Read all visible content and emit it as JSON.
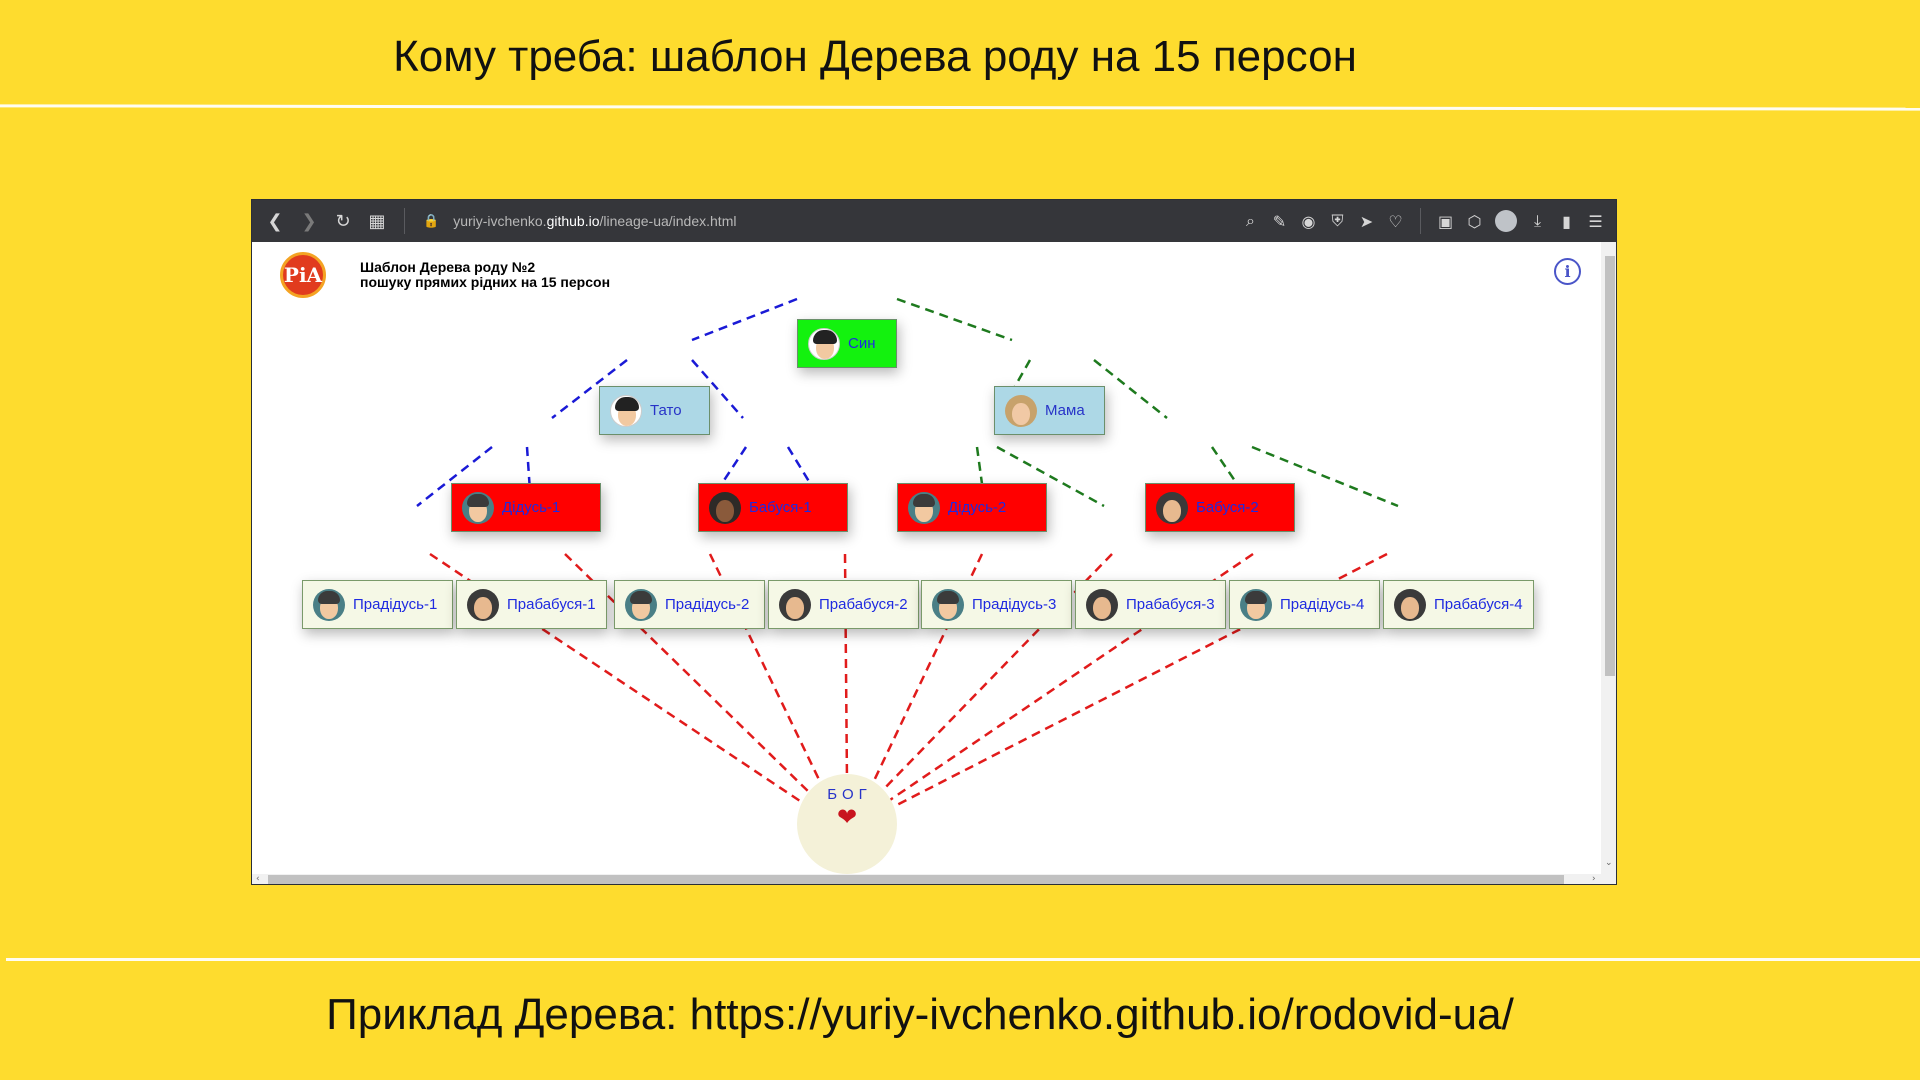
{
  "slide": {
    "title": "Кому треба: шаблон Дерева роду на 15 персон",
    "footer": "Приклад Дерева: https://yuriy-ivchenko.github.io/rodovid-ua/"
  },
  "browser": {
    "url_prefix": "yuriy-ivchenko.",
    "url_host": "github.io",
    "url_path": "/lineage-ua/index.html"
  },
  "page": {
    "logo_text": "PiA",
    "heading_line1": "Шаблон Дерева роду №2",
    "heading_line2": "пошуку прямих рідних на 15 персон"
  },
  "tree": {
    "son": {
      "label": "Син",
      "icon": "boy-avatar-icon"
    },
    "father": {
      "label": "Тато",
      "icon": "man-avatar-icon"
    },
    "mother": {
      "label": "Мама",
      "icon": "woman-avatar-icon"
    },
    "grandparents": [
      {
        "label": "Дідусь-1",
        "icon": "man-avatar-icon"
      },
      {
        "label": "Бабуся-1",
        "icon": "woman-avatar-icon"
      },
      {
        "label": "Дідусь-2",
        "icon": "man-avatar-icon"
      },
      {
        "label": "Бабуся-2",
        "icon": "woman-avatar-icon"
      }
    ],
    "great_grandparents": [
      {
        "label": "Прадідусь-1",
        "icon": "man-avatar-icon"
      },
      {
        "label": "Прабабуся-1",
        "icon": "woman-avatar-icon"
      },
      {
        "label": "Прадідусь-2",
        "icon": "man-avatar-icon"
      },
      {
        "label": "Прабабуся-2",
        "icon": "woman-avatar-icon"
      },
      {
        "label": "Прадідусь-3",
        "icon": "man-avatar-icon"
      },
      {
        "label": "Прабабуся-3",
        "icon": "woman-avatar-icon"
      },
      {
        "label": "Прадідусь-4",
        "icon": "man-avatar-icon"
      },
      {
        "label": "Прабабуся-4",
        "icon": "woman-avatar-icon"
      }
    ],
    "root": {
      "label": "БОГ",
      "icon": "heart-icon"
    }
  },
  "colors": {
    "slide_background": "#FEDC2E",
    "son": "#13F20E",
    "parents": "#ADD8E6",
    "grandparents": "#FF0000",
    "great_grandparents": "#F5F8E6",
    "paternal_link": "#1A1AD6",
    "maternal_link": "#1E7A1E",
    "root_link": "#E11B1B"
  }
}
